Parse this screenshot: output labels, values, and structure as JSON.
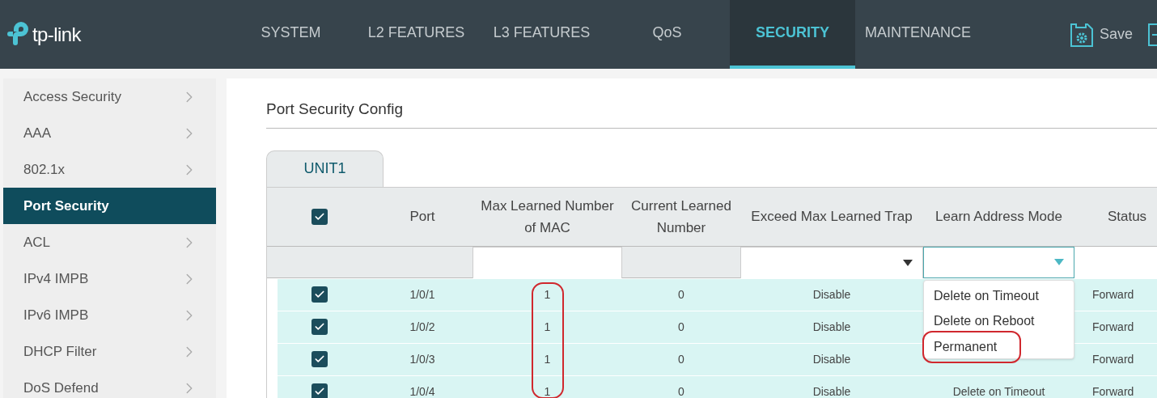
{
  "header": {
    "logo_text": "tp-link",
    "nav": [
      {
        "label": "SYSTEM",
        "selected": false
      },
      {
        "label": "L2 FEATURES",
        "selected": false
      },
      {
        "label": "L3 FEATURES",
        "selected": false
      },
      {
        "label": "QoS",
        "selected": false
      },
      {
        "label": "SECURITY",
        "selected": true
      },
      {
        "label": "MAINTENANCE",
        "selected": false
      }
    ],
    "save_label": "Save"
  },
  "sidebar": {
    "items": [
      {
        "label": "Access Security",
        "selected": false
      },
      {
        "label": "AAA",
        "selected": false
      },
      {
        "label": "802.1x",
        "selected": false
      },
      {
        "label": "Port Security",
        "selected": true
      },
      {
        "label": "ACL",
        "selected": false
      },
      {
        "label": "IPv4 IMPB",
        "selected": false
      },
      {
        "label": "IPv6 IMPB",
        "selected": false
      },
      {
        "label": "DHCP Filter",
        "selected": false
      },
      {
        "label": "DoS Defend",
        "selected": false
      }
    ]
  },
  "page_title": "Port Security Config",
  "tabs": [
    {
      "label": "UNIT1",
      "selected": true
    }
  ],
  "table": {
    "select_all_checked": true,
    "max_learned_outlined": true,
    "columns": [
      {
        "label": "Port"
      },
      {
        "label": "Max Learned Number of MAC"
      },
      {
        "label": "Current Learned Number"
      },
      {
        "label": "Exceed Max Learned Trap"
      },
      {
        "label": "Learn Address Mode"
      },
      {
        "label": "Status"
      }
    ],
    "dropdown": {
      "options": [
        {
          "label": "Delete on Timeout",
          "highlighted": false
        },
        {
          "label": "Delete on Reboot",
          "highlighted": false
        },
        {
          "label": "Permanent",
          "highlighted": true
        }
      ]
    },
    "rows": [
      {
        "checked": true,
        "port": "1/0/1",
        "max_learned": "1",
        "current_learned": "0",
        "exceed_trap": "Disable",
        "status": "Forward"
      },
      {
        "checked": true,
        "port": "1/0/2",
        "max_learned": "1",
        "current_learned": "0",
        "exceed_trap": "Disable",
        "status": "Forward"
      },
      {
        "checked": true,
        "port": "1/0/3",
        "max_learned": "1",
        "current_learned": "0",
        "exceed_trap": "Disable",
        "status": "Forward"
      },
      {
        "checked": true,
        "port": "1/0/4",
        "max_learned": "1",
        "current_learned": "0",
        "exceed_trap": "Disable",
        "learn_mode": "Delete on Timeout",
        "status": "Forward"
      }
    ]
  }
}
